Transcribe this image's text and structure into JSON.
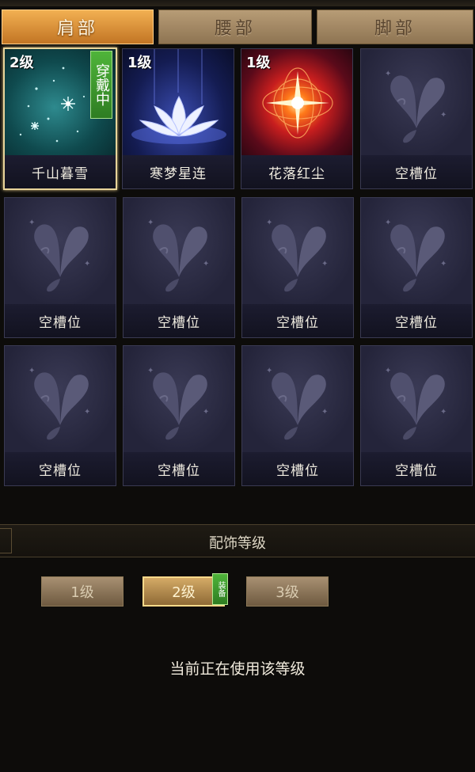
{
  "tabs": [
    {
      "label": "肩部",
      "active": true
    },
    {
      "label": "腰部",
      "active": false
    },
    {
      "label": "脚部",
      "active": false
    }
  ],
  "slots": [
    {
      "name": "千山暮雪",
      "level": "2级",
      "wearing": true,
      "wear_badge": "穿戴中"
    },
    {
      "name": "寒梦星连",
      "level": "1级"
    },
    {
      "name": "花落红尘",
      "level": "1级"
    },
    {
      "name": "空槽位"
    },
    {
      "name": "空槽位"
    },
    {
      "name": "空槽位"
    },
    {
      "name": "空槽位"
    },
    {
      "name": "空槽位"
    },
    {
      "name": "空槽位"
    },
    {
      "name": "空槽位"
    },
    {
      "name": "空槽位"
    },
    {
      "name": "空槽位"
    }
  ],
  "level_section": {
    "title": "配饰等级",
    "levels": [
      "1级",
      "2级",
      "3级"
    ],
    "selected": "2级",
    "equip_badge": "装备",
    "status_text": "当前正在使用该等级"
  }
}
